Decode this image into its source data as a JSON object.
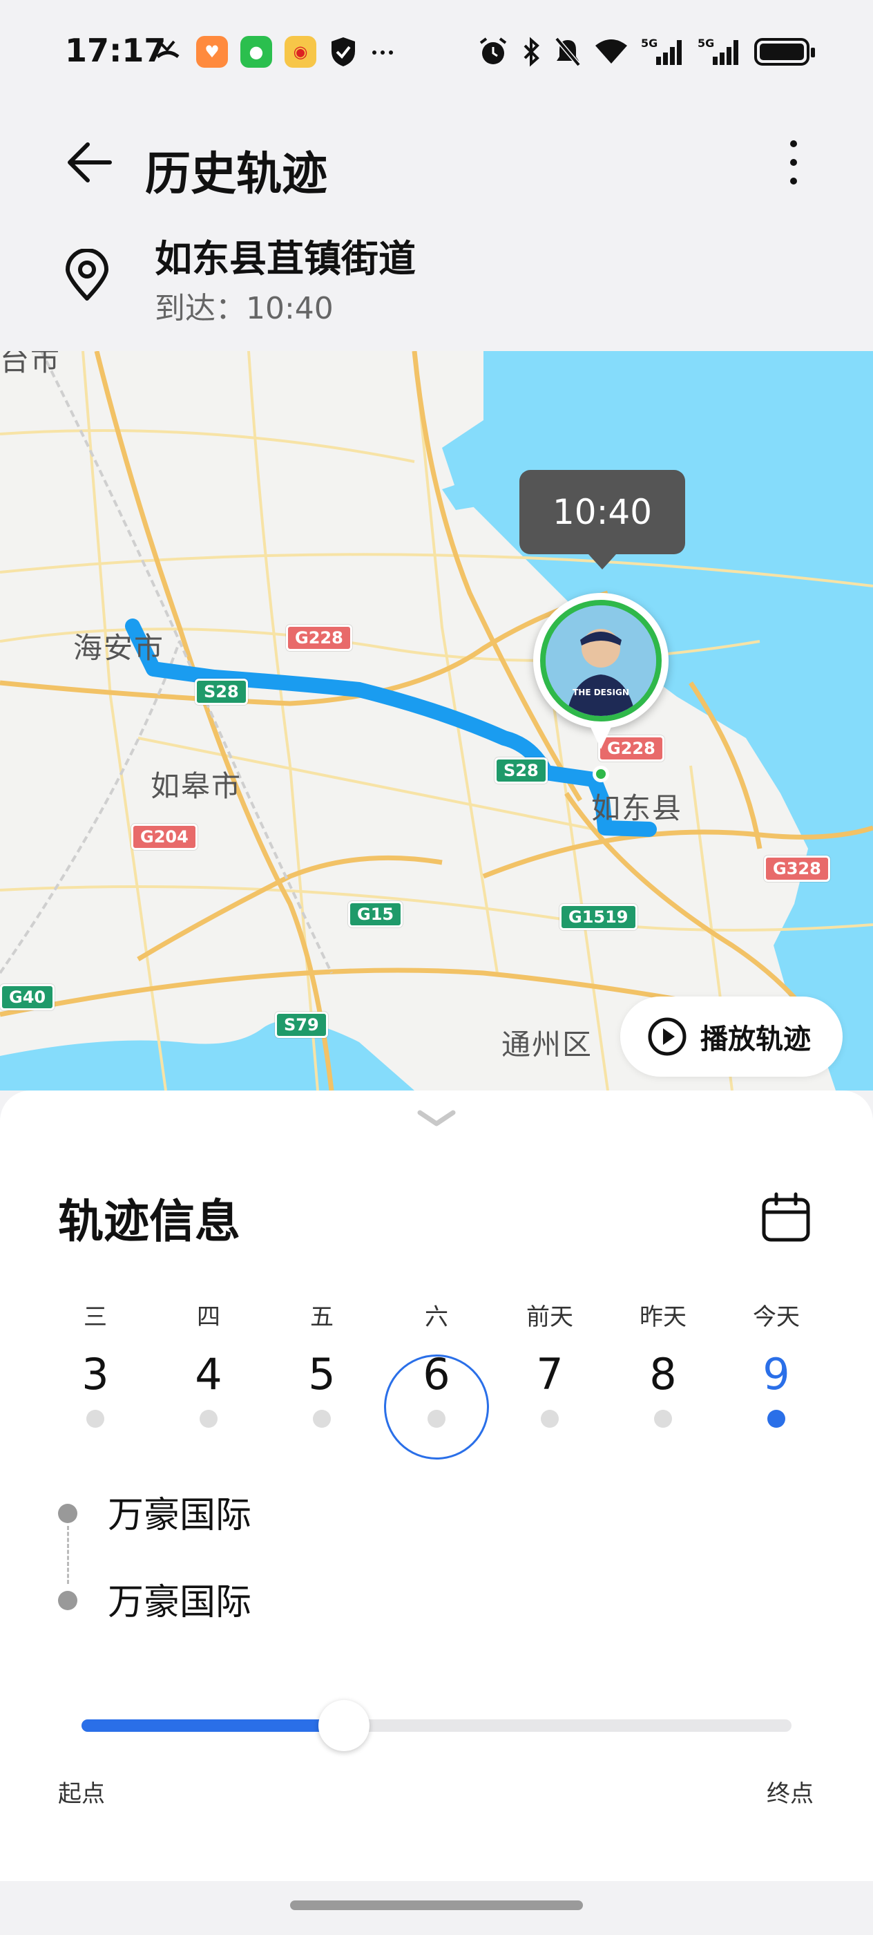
{
  "status_bar": {
    "time": "17:17",
    "left_icons": [
      "missed-call-icon",
      "heart-app-icon",
      "wechat-icon",
      "weibo-icon",
      "shield-icon",
      "more-notifications-icon"
    ],
    "right_icons": [
      "alarm-icon",
      "bluetooth-icon",
      "mute-icon",
      "wifi-icon",
      "5g-signal-icon",
      "5g-signal-icon",
      "battery-icon"
    ],
    "signal_label": "5G",
    "battery_level": 1.0
  },
  "header": {
    "title": "历史轨迹",
    "back_icon": "arrow-left-icon",
    "more_icon": "more-vertical-icon"
  },
  "location": {
    "name": "如东县苴镇街道",
    "arrival": "到达：10:40"
  },
  "map": {
    "labels": {
      "haian": "海安市",
      "rugao": "如皋市",
      "rudong": "如东县",
      "tongzhou": "通州区",
      "top_clip": "台市"
    },
    "highways": {
      "g228_a": "G228",
      "g228_b": "G228",
      "s28_a": "S28",
      "s28_b": "S28",
      "g204": "G204",
      "g15": "G15",
      "g1519": "G1519",
      "g328": "G328",
      "s79": "S79",
      "g40": "G40"
    },
    "time_bubble": "10:40",
    "avatar_text": "THE DESIGN",
    "play_button": "播放轨迹",
    "colors": {
      "sea": "#85dcfb",
      "route": "#1a9cf0",
      "road_major": "#f2c266",
      "road_minor": "#f7e3a6"
    }
  },
  "sheet": {
    "title": "轨迹信息",
    "calendar_icon": "calendar-icon",
    "days": [
      {
        "week": "三",
        "num": "3",
        "has_track": false,
        "selected": false,
        "today": false
      },
      {
        "week": "四",
        "num": "4",
        "has_track": false,
        "selected": false,
        "today": false
      },
      {
        "week": "五",
        "num": "5",
        "has_track": false,
        "selected": false,
        "today": false
      },
      {
        "week": "六",
        "num": "6",
        "has_track": false,
        "selected": true,
        "today": false
      },
      {
        "week": "前天",
        "num": "7",
        "has_track": false,
        "selected": false,
        "today": false
      },
      {
        "week": "昨天",
        "num": "8",
        "has_track": false,
        "selected": false,
        "today": false
      },
      {
        "week": "今天",
        "num": "9",
        "has_track": true,
        "selected": false,
        "today": true
      }
    ],
    "timeline": {
      "start": "万豪国际",
      "end": "万豪国际"
    },
    "progress": {
      "value": 0.37,
      "start_label": "起点",
      "end_label": "终点"
    },
    "accent": "#2a6fe8"
  }
}
